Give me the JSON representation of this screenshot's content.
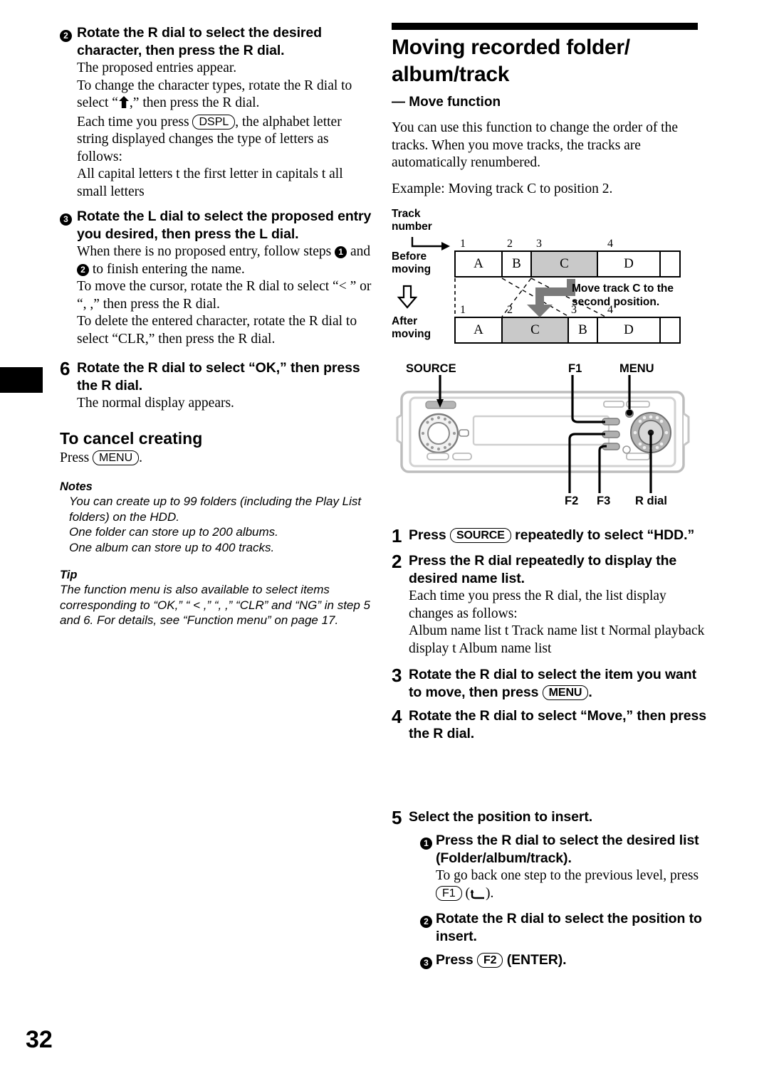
{
  "page": {
    "number": "32"
  },
  "left_column": {
    "step2": {
      "marker": "2",
      "heading": "Rotate the R dial to select the desired character, then press the R dial.",
      "line1": "The proposed entries appear.",
      "line2_a": "To change the character types, rotate the R dial to select “",
      "line2_b": ",” then press the R dial.",
      "line3_a": "Each time you press ",
      "button": "DSPL",
      "line3_b": ", the alphabet letter string displayed changes the type of letters as follows:",
      "line4": "All capital letters t    the first letter in capitals t    all small letters"
    },
    "step3": {
      "marker": "3",
      "heading": "Rotate the L dial to select the proposed entry you desired, then press the L dial.",
      "line1_a": "When there is no proposed entry, follow steps ",
      "sub1": "1",
      "line1_b": " and ",
      "sub2": "2",
      "line1_c": " to finish entering the name.",
      "line2": "To move the cursor, rotate the R dial to select “<  ” or “,   ,” then press the R dial.",
      "line3": "To delete the entered character, rotate the R dial to select “CLR,” then press the R dial."
    },
    "step6": {
      "marker": "6",
      "heading": "Rotate the R dial to select “OK,” then press the R dial.",
      "line1": "The normal display appears."
    },
    "cancel": {
      "heading": "To cancel creating",
      "press_label": "Press ",
      "button": "MENU",
      "period": "."
    },
    "notes": {
      "title": "Notes",
      "items": [
        "You can create up to 99 folders (including the Play List folders) on the HDD.",
        "One folder can store up to 200 albums.",
        "One album can store up to 400 tracks."
      ]
    },
    "tip": {
      "title": "Tip",
      "text": "The function menu is also available to select items corresponding to “OK,” “ <   ,” “,     ,” “CLR” and “NG” in step 5 and 6. For details, see “Function menu” on page 17."
    }
  },
  "right_column": {
    "title_line1": "Moving recorded folder/",
    "title_line2": "album/track",
    "subtitle": "— Move function",
    "intro": "You can use this function to change the order of the tracks. When you move tracks, the tracks are automatically renumbered.",
    "example": "Example: Moving track C to position 2.",
    "diagram": {
      "track_number_label_line1": "Track",
      "track_number_label_line2": "number",
      "before_label_line1": "Before",
      "before_label_line2": "moving",
      "after_label_line1": "After",
      "after_label_line2": "moving",
      "before_ticks": [
        "1",
        "2",
        "3",
        "4"
      ],
      "after_ticks": [
        "1",
        "2",
        "3",
        "4"
      ],
      "before_cells": [
        "A",
        "B",
        "C",
        "D"
      ],
      "after_cells": [
        "A",
        "C",
        "B",
        "D"
      ],
      "before_highlight": "C",
      "after_highlight": "C",
      "callout_line1": "Move track C to the",
      "callout_line2": "second position.",
      "shade_color": "#c9c9c9",
      "arrow_color": "#7a7a7a"
    },
    "device": {
      "label_source": "SOURCE",
      "label_f1": "F1",
      "label_menu": "MENU",
      "label_f2": "F2",
      "label_f3": "F3",
      "label_rdial": "R dial"
    },
    "step1": {
      "marker": "1",
      "head_a": "Press ",
      "button": "SOURCE",
      "head_b": " repeatedly to select “HDD.”"
    },
    "step2": {
      "marker": "2",
      "heading": "Press the R dial repeatedly to display the desired name list.",
      "line1": "Each time you press the R dial, the list display changes as follows:",
      "line2": "Album name list t    Track name list t    Normal playback display t    Album name list"
    },
    "step3": {
      "marker": "3",
      "head_a": "Rotate the R dial to select the item you want to move, then press ",
      "button": "MENU",
      "head_b": "."
    },
    "step4": {
      "marker": "4",
      "heading": "Rotate the R dial to select “Move,” then press the R dial."
    },
    "step5": {
      "marker": "5",
      "heading": "Select the position to insert.",
      "sub1": {
        "marker": "1",
        "heading": "Press the R dial to select the desired list (Folder/album/track).",
        "line_a": "To go back one step to the previous level, press ",
        "button": "F1",
        "line_b": " (  ).",
        "glyph": "↵"
      },
      "sub2": {
        "marker": "2",
        "heading": "Rotate the R dial to select the position to insert."
      },
      "sub3": {
        "marker": "3",
        "head_a": "Press ",
        "button": "F2",
        "head_b": " (ENTER)."
      }
    }
  }
}
